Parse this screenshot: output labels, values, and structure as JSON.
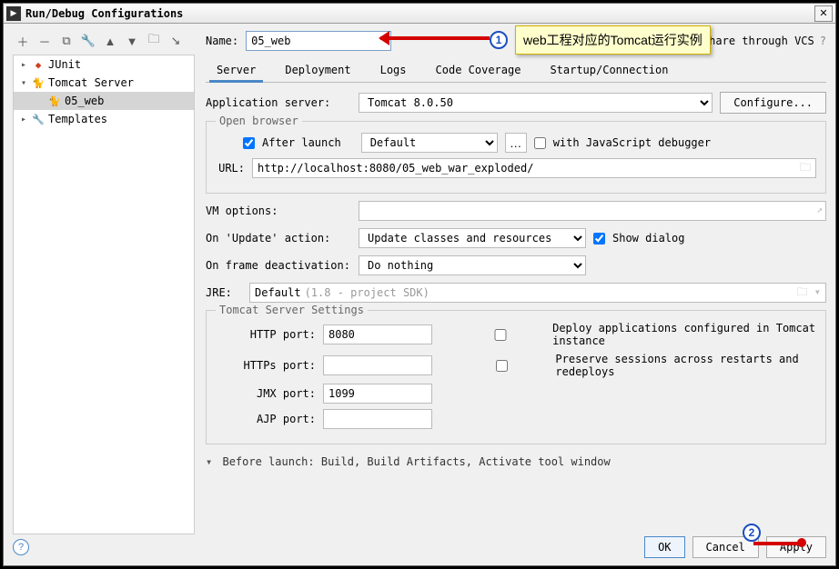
{
  "window": {
    "title": "Run/Debug Configurations"
  },
  "sidebar": {
    "items": [
      {
        "label": "JUnit"
      },
      {
        "label": "Tomcat Server"
      },
      {
        "label": "05_web"
      },
      {
        "label": "Templates"
      }
    ]
  },
  "name": {
    "label": "Name:",
    "value": "05_web"
  },
  "shareLabel": "Share through VCS",
  "tabs": [
    "Server",
    "Deployment",
    "Logs",
    "Code Coverage",
    "Startup/Connection"
  ],
  "appServer": {
    "label": "Application server:",
    "value": "Tomcat 8.0.50",
    "configureBtn": "Configure..."
  },
  "openBrowser": {
    "legend": "Open browser",
    "afterLaunch": "After launch",
    "browser": "Default",
    "withJsDbg": "with JavaScript debugger",
    "urlLabel": "URL:",
    "url": "http://localhost:8080/05_web_war_exploded/"
  },
  "vmLabel": "VM options:",
  "onUpdate": {
    "label": "On 'Update' action:",
    "value": "Update classes and resources",
    "showDialog": "Show dialog"
  },
  "onFrame": {
    "label": "On frame deactivation:",
    "value": "Do nothing"
  },
  "jre": {
    "label": "JRE:",
    "value": "Default",
    "hint": "(1.8 - project SDK)"
  },
  "tomcatSettings": {
    "legend": "Tomcat Server Settings",
    "httpPortLabel": "HTTP port:",
    "httpPort": "8080",
    "httpsPortLabel": "HTTPs port:",
    "httpsPort": "",
    "jmxPortLabel": "JMX port:",
    "jmxPort": "1099",
    "ajpPortLabel": "AJP port:",
    "ajpPort": "",
    "deployChk": "Deploy applications configured in Tomcat instance",
    "preserveChk": "Preserve sessions across restarts and redeploys"
  },
  "beforeLaunch": "Before launch: Build, Build Artifacts, Activate tool window",
  "buttons": {
    "ok": "OK",
    "cancel": "Cancel",
    "apply": "Apply"
  },
  "annotation1": "web工程对应的Tomcat运行实例"
}
